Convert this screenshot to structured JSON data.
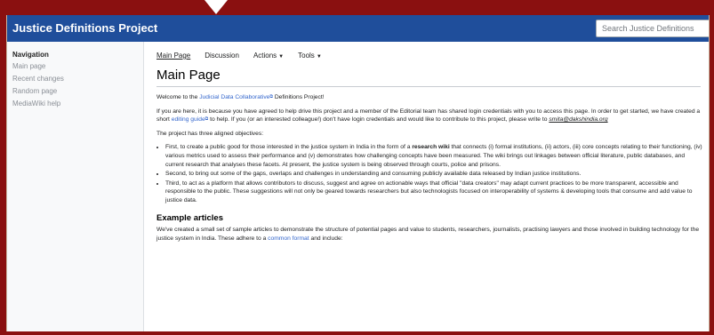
{
  "header": {
    "site_title": "Justice Definitions Project",
    "search_placeholder": "Search Justice Definitions"
  },
  "sidebar": {
    "heading": "Navigation",
    "items": [
      "Main page",
      "Recent changes",
      "Random page",
      "MediaWiki help"
    ]
  },
  "tabs": {
    "main_page": "Main Page",
    "discussion": "Discussion",
    "actions": "Actions",
    "tools": "Tools"
  },
  "page": {
    "title": "Main Page",
    "welcome": {
      "before": "Welcome to the ",
      "link": "Judicial Data Collaborative",
      "after": " Definitions Project!"
    },
    "intro": {
      "part1": "If you are here, it is because you have agreed to help drive this project and a member of the Editorial team has shared login credentials with you to access this page. In order to get started, we have created a short ",
      "link": "editing guide",
      "part2": " to help. If you (or an interested colleague!) don't have login credentials and would like to contribute to this project, please write to ",
      "email": "smita@dakshindia.org"
    },
    "objectives_intro": "The project has three aligned objectives:",
    "objectives": {
      "first_a": "First, to create a public good for those interested in the justice system in India in the form of a ",
      "first_bold": "research wiki",
      "first_b": " that connects (i) formal institutions, (ii) actors, (iii) core concepts relating to their functioning, (iv) various metrics used to assess their performance and (v) demonstrates how challenging concepts have been measured. The wiki brings out linkages between official literature, public databases, and current research that analyses these facets. At present, the justice system is being observed through courts, police and prisons.",
      "second": "Second, to bring out some of the gaps, overlaps and challenges in understanding and consuming publicly available data released by Indian justice institutions.",
      "third": "Third, to act as a platform that allows contributors to discuss, suggest and agree on actionable ways that official \"data creators\" may adapt current practices to be more transparent, accessible and responsible to the public. These suggestions will not only be geared towards researchers but also technologists focused on interoperability of systems & developing tools that consume and add value to justice data."
    },
    "example_heading": "Example articles",
    "example": {
      "text": "We've created a small set of sample articles to demonstrate the structure of potential pages and value to students, researchers, journalists, practising lawyers and those involved in building technology for the justice system in India. These adhere to a ",
      "link": "common format",
      "after": " and include:"
    }
  },
  "colors": {
    "header_bg": "#1f4e9b",
    "outer_bg": "#8a1010",
    "link": "#3366cc"
  }
}
